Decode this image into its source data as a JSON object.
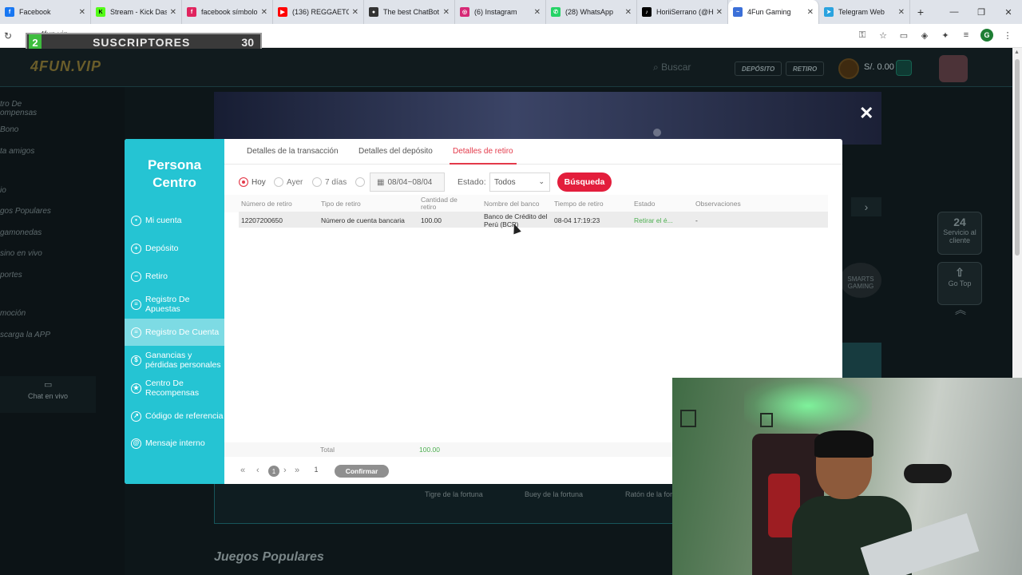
{
  "browser": {
    "tabs": [
      {
        "label": "Facebook",
        "color": "#1877f2",
        "glyph": "f"
      },
      {
        "label": "Stream - Kick Das",
        "color": "#53fc18",
        "glyph": "K"
      },
      {
        "label": "facebook símbolo",
        "color": "#e0245e",
        "glyph": "f"
      },
      {
        "label": "(136) REGGAETON",
        "color": "#ff0000",
        "glyph": "▶"
      },
      {
        "label": "The best ChatBot",
        "color": "#333333",
        "glyph": "●"
      },
      {
        "label": "(6) Instagram",
        "color": "#d62976",
        "glyph": "◎"
      },
      {
        "label": "(28) WhatsApp",
        "color": "#25d366",
        "glyph": "✆"
      },
      {
        "label": "HoriiSerrano (@H",
        "color": "#000000",
        "glyph": "♪"
      },
      {
        "label": "4Fun Gaming",
        "color": "#3b6fd8",
        "glyph": "~"
      },
      {
        "label": "Telegram Web",
        "color": "#2aa3df",
        "glyph": "➤"
      }
    ],
    "active_tab_index": 8,
    "new_tab": "+",
    "window_controls": {
      "minimize": "—",
      "maximize": "❐",
      "close": "✕"
    },
    "url": "4fun.vip",
    "profile_initial": "G"
  },
  "stream_overlay": {
    "badge": "2",
    "label": "SUSCRIPTORES",
    "count": "30"
  },
  "site": {
    "logo": "4FUN.VIP",
    "search_placeholder": "Buscar",
    "deposit_button": "DEPÓSITO",
    "withdraw_button": "RETIRO",
    "balance": "S/. 0.00",
    "sidebar": [
      "tro De\nompensas",
      "Bono",
      "ta amigos",
      "io",
      "gos Populares",
      "gamonedas",
      "sino en vivo",
      "portes",
      "moción",
      "scarga la APP"
    ],
    "chat_live": "Chat en vivo",
    "sponsor_text": "SMARTS GAMING",
    "float_service": {
      "big": "24",
      "label": "Servicio al cliente"
    },
    "float_top": {
      "label": "Go Top"
    },
    "games": [
      "Tigre de la fortuna",
      "Buey de la fortuna",
      "Ratón de la fortu"
    ],
    "popular_title": "Juegos Populares",
    "close_symbol": "✕"
  },
  "modal": {
    "title_line1": "Persona",
    "title_line2": "Centro",
    "menu": [
      {
        "label": "Mi cuenta",
        "icon": "user-icon"
      },
      {
        "label": "Depósito",
        "icon": "deposit-icon"
      },
      {
        "label": "Retiro",
        "icon": "withdraw-icon"
      },
      {
        "label": "Registro De Apuestas",
        "icon": "bets-icon"
      },
      {
        "label": "Registro De Cuenta",
        "icon": "account-record-icon",
        "active": true
      },
      {
        "label": "Ganancias y pérdidas personales",
        "icon": "profit-loss-icon"
      },
      {
        "label": "Centro De Recompensas",
        "icon": "rewards-icon"
      },
      {
        "label": "Código de referencia",
        "icon": "referral-icon"
      },
      {
        "label": "Mensaje interno",
        "icon": "message-icon"
      }
    ],
    "tabs": [
      "Detalles de la transacción",
      "Detalles del depósito",
      "Detalles de retiro"
    ],
    "active_tab": 2,
    "filters": {
      "hoy": "Hoy",
      "ayer": "Ayer",
      "siete_dias": "7 días",
      "date_range": "08/04~08/04",
      "estado_label": "Estado:",
      "estado_value": "Todos",
      "search_button": "Búsqueda"
    },
    "table": {
      "headers": [
        "Número de retiro",
        "Tipo de retiro",
        "Cantidad de retiro",
        "Nombre del banco",
        "Tiempo de retiro",
        "Estado",
        "Observaciones"
      ],
      "rows": [
        {
          "numero": "12207200650",
          "tipo": "Número de cuenta bancaria",
          "cantidad": "100.00",
          "banco": "Banco de Crédito del Perú (BCP)",
          "tiempo": "08-04 17:19:23",
          "estado": "Retirar el é...",
          "observaciones": "-"
        }
      ],
      "total_label": "Total",
      "total_value": "100.00"
    },
    "pager": {
      "first": "«",
      "prev": "‹",
      "current": "1",
      "next": "›",
      "last": "»",
      "input": "1",
      "confirm": "Confirmar"
    }
  },
  "colors": {
    "accent_teal": "#25c4d3",
    "accent_red": "#e31e3c",
    "status_green": "#4caf50"
  }
}
